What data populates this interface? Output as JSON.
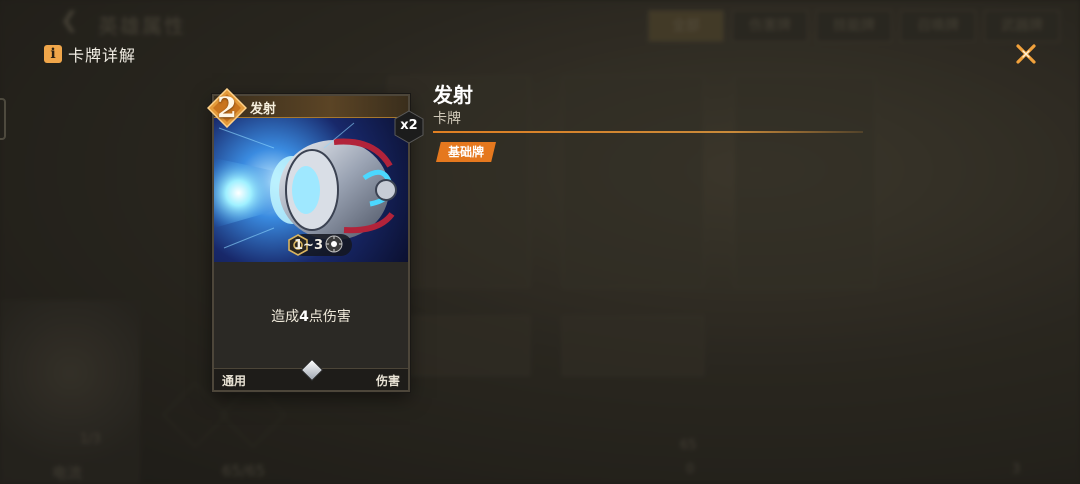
{
  "background": {
    "page_title": "英雄属性",
    "tabs": [
      "全部",
      "伤害牌",
      "技能牌",
      "召唤牌",
      "武器牌"
    ],
    "stat_hero_count": "1/3",
    "stat_element": "电流",
    "stat_energy": "65/65",
    "stat_right_top": "65",
    "stat_right_bottom": "0",
    "stat_far_right": "3"
  },
  "dialog": {
    "title": "卡牌详解",
    "info_icon": "i",
    "close_icon": "close-x-icon"
  },
  "card": {
    "cost": "2",
    "name": "发射",
    "range": "1~3",
    "description_prefix": "造成",
    "description_value": "4",
    "description_suffix": "点伤害",
    "footer_left": "通用",
    "footer_right": "伤害",
    "count": "x2"
  },
  "info": {
    "name": "发射",
    "type": "卡牌",
    "tag": "基础牌"
  },
  "colors": {
    "accent_orange": "#e5781e",
    "cost_gold": "#e39a3a",
    "tag_orange": "#e5781e"
  }
}
